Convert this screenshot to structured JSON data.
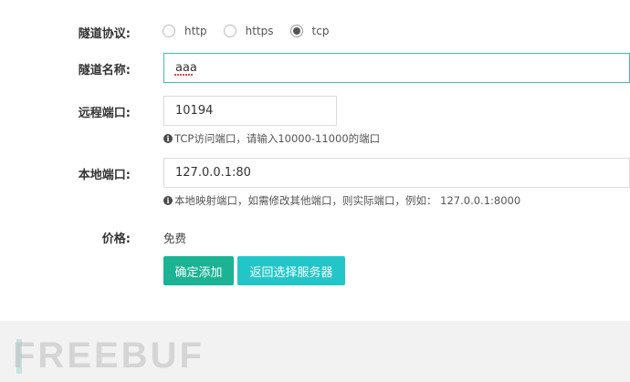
{
  "form": {
    "protocol": {
      "label": "隧道协议:",
      "options": [
        {
          "label": "http",
          "checked": false
        },
        {
          "label": "https",
          "checked": false
        },
        {
          "label": "tcp",
          "checked": true
        }
      ]
    },
    "name": {
      "label": "隧道名称:",
      "value": "aaa"
    },
    "remote_port": {
      "label": "远程端口:",
      "value": "10194",
      "hint": "TCP访问端口，请输入10000-11000的端口"
    },
    "local_port": {
      "label": "本地端口:",
      "value": "127.0.0.1:80",
      "hint": "本地映射端口，如需修改其他端口，则实际端口，例如： 127.0.0.1:8000"
    },
    "price": {
      "label": "价格:",
      "value": "免费"
    },
    "buttons": {
      "confirm": "确定添加",
      "back": "返回选择服务器"
    }
  },
  "watermark": "FREEBUF",
  "colors": {
    "primary": "#1bb394",
    "info": "#23c6c8",
    "focus_border": "#3cc2a6"
  }
}
